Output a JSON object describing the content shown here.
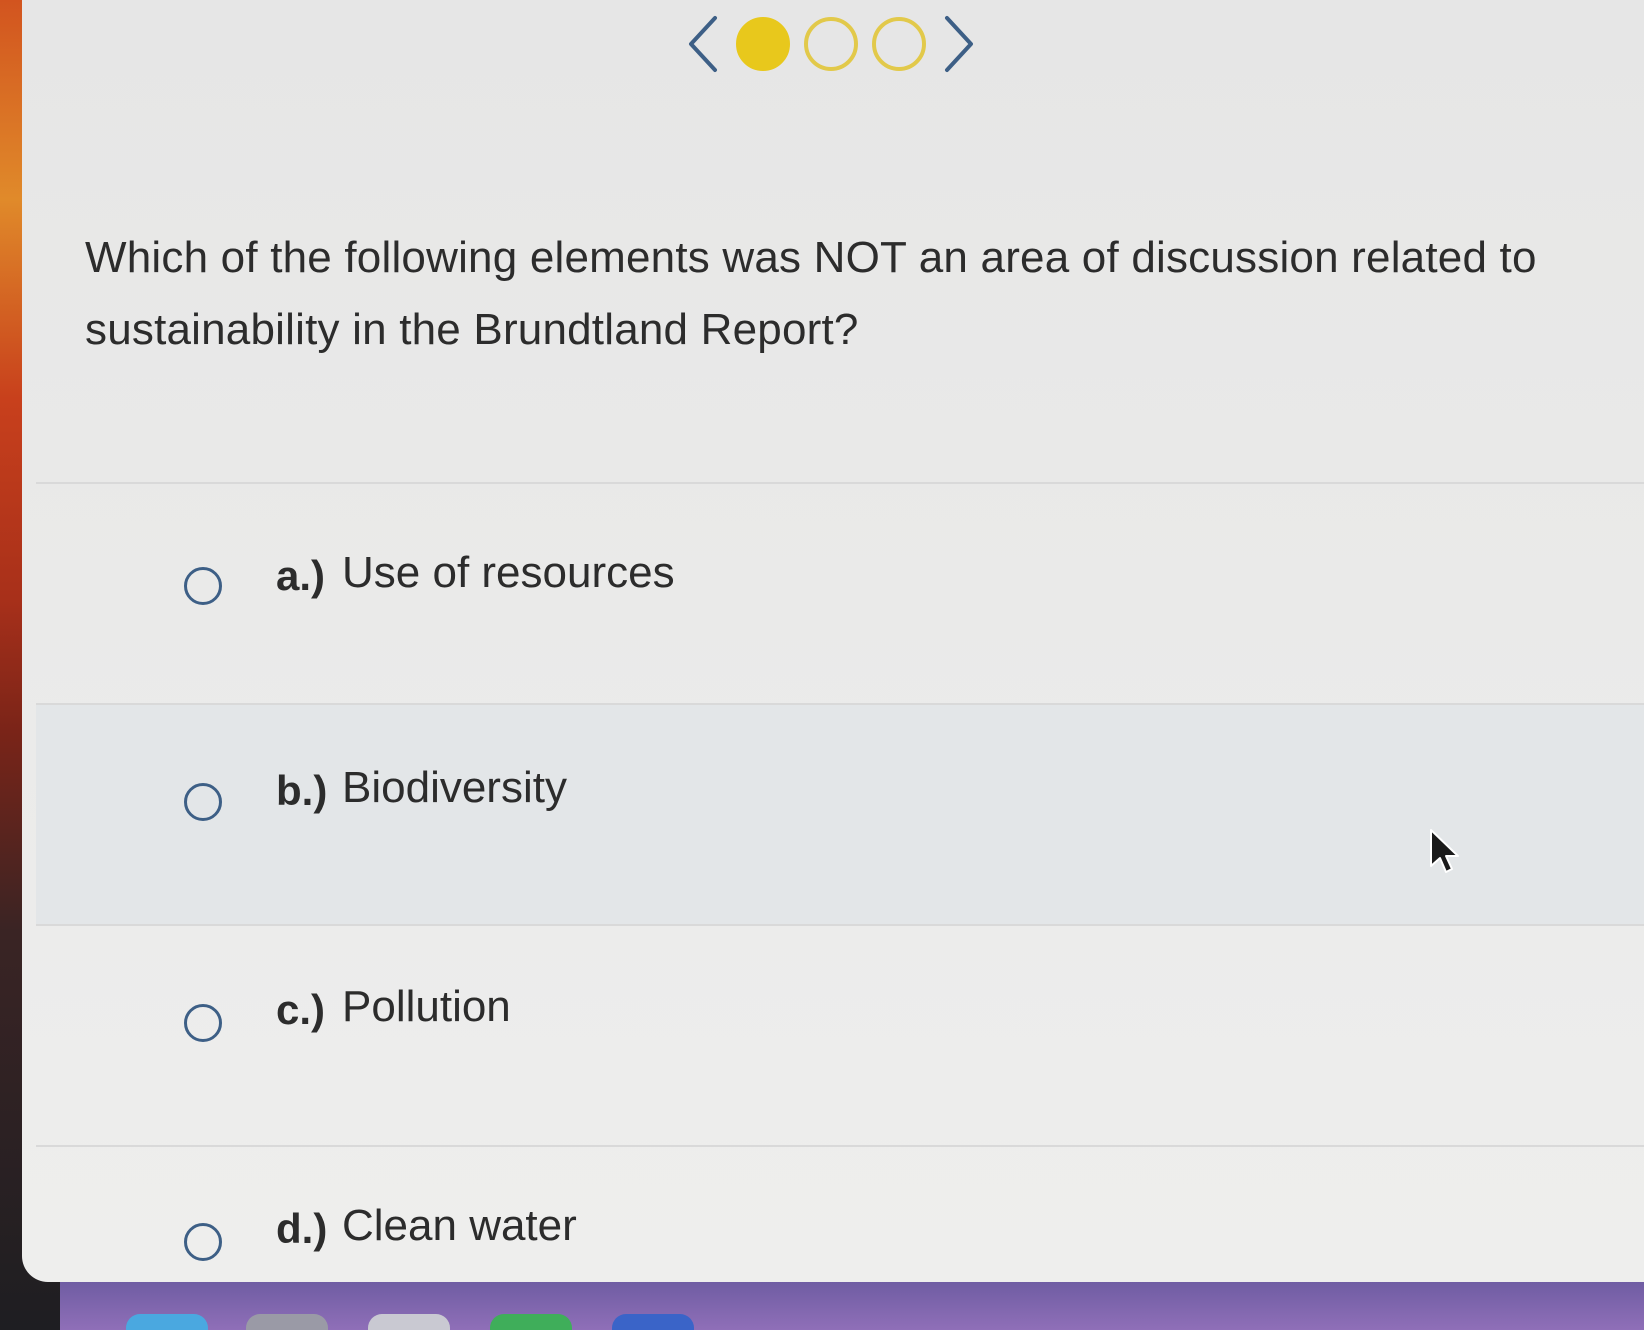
{
  "carousel": {
    "prev_icon": "chevron-left-icon",
    "next_icon": "chevron-right-icon",
    "dots": [
      {
        "state": "filled"
      },
      {
        "state": "empty"
      },
      {
        "state": "empty"
      }
    ],
    "accent_color": "#e8c81c",
    "arrow_color": "#3d5f86"
  },
  "question": {
    "text": "Which of the following elements was NOT an area of discussion related to sustainability in the Brundtland Report?"
  },
  "options": [
    {
      "letter": "a.)",
      "text": "Use of resources"
    },
    {
      "letter": "b.)",
      "text": "Biodiversity"
    },
    {
      "letter": "c.)",
      "text": "Pollution"
    },
    {
      "letter": "d.)",
      "text": "Clean water"
    }
  ],
  "colors": {
    "radio": "#3d5f86",
    "text": "#2c2c2c",
    "background": "#ebebea"
  }
}
